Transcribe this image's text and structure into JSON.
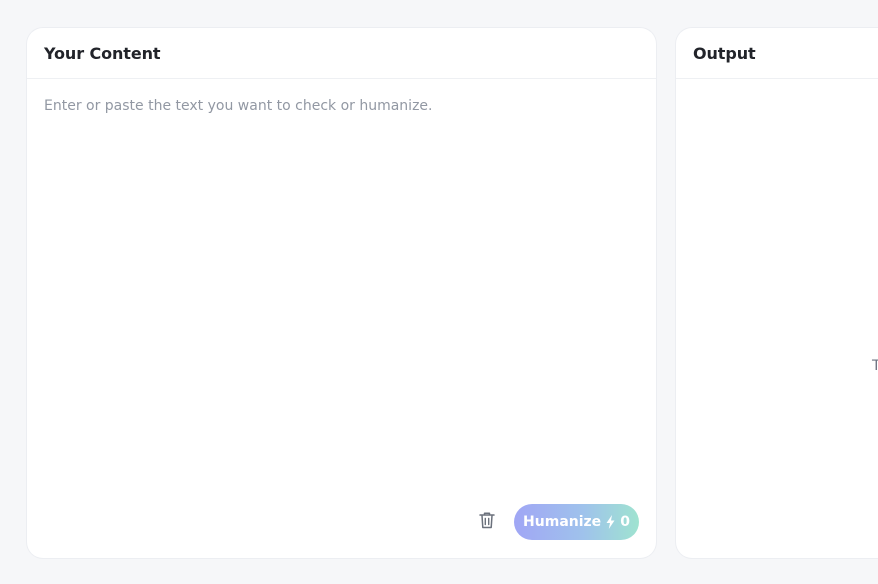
{
  "input_panel": {
    "title": "Your Content",
    "placeholder": "Enter or paste the text you want to check or humanize.",
    "value": "",
    "trash_icon": "trash-icon",
    "humanize_button": {
      "label": "Humanize",
      "icon": "lightning-bolt-icon",
      "credit_count": "0"
    }
  },
  "output_panel": {
    "title": "Output",
    "partial_text": "T"
  },
  "colors": {
    "background": "#f6f7f9",
    "panel": "#ffffff",
    "title": "#22242a",
    "placeholder": "#9298a3",
    "button_gradient_start": "#a0a6f5",
    "button_gradient_end": "#9fe3d0"
  }
}
